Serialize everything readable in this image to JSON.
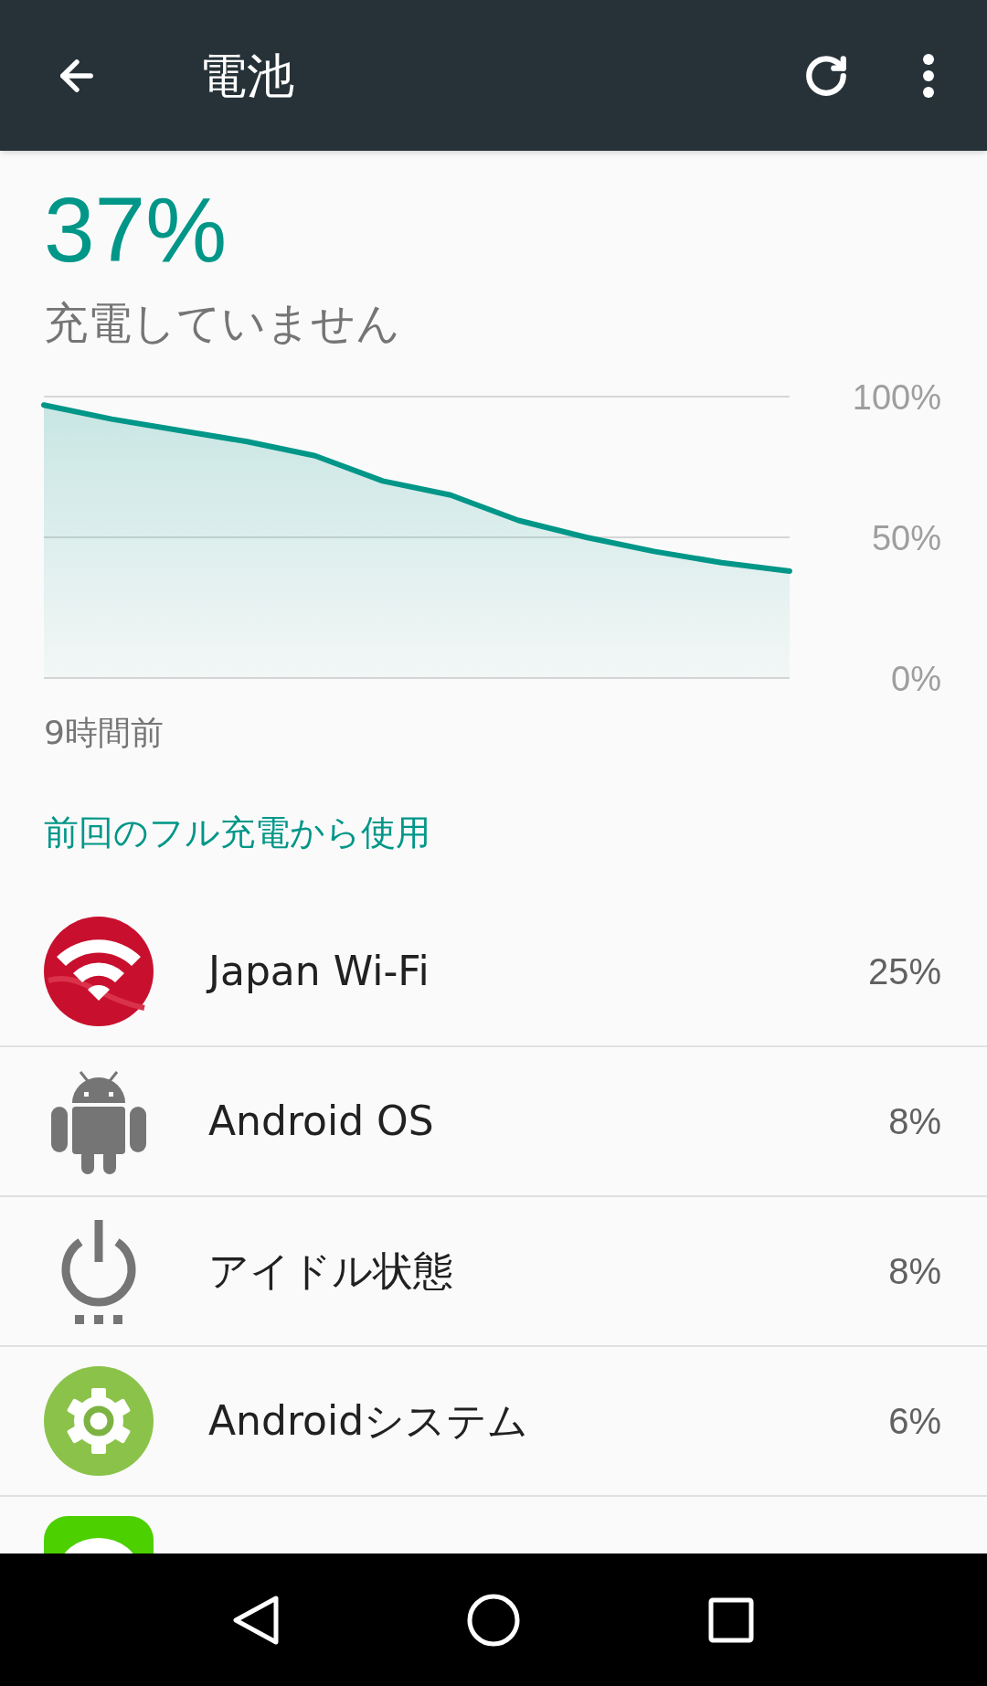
{
  "app_bar": {
    "title": "電池"
  },
  "battery": {
    "percent": "37%",
    "status": "充電していません"
  },
  "chart_data": {
    "type": "area",
    "ylim": [
      0,
      100
    ],
    "yticks": [
      {
        "value": 100,
        "label": "100%"
      },
      {
        "value": 50,
        "label": "50%"
      },
      {
        "value": 0,
        "label": "0%"
      }
    ],
    "series": [
      {
        "color": "#009688",
        "values": [
          97,
          92,
          88,
          84,
          79,
          70,
          65,
          56,
          50,
          45,
          41,
          38
        ]
      }
    ]
  },
  "time_label": "9時間前",
  "section_header": "前回のフル充電から使用",
  "apps": [
    {
      "kind": "wifi",
      "name": "Japan Wi-Fi",
      "usage": "25%"
    },
    {
      "kind": "android",
      "name": "Android OS",
      "usage": "8%"
    },
    {
      "kind": "idle",
      "name": "アイドル状態",
      "usage": "8%"
    },
    {
      "kind": "system",
      "name": "Androidシステム",
      "usage": "6%"
    },
    {
      "kind": "chat"
    }
  ]
}
